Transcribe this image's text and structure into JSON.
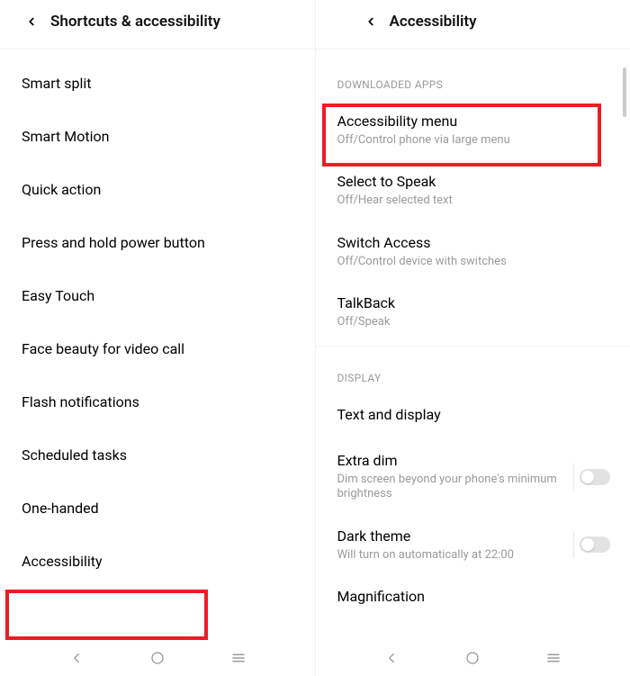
{
  "left": {
    "title": "Shortcuts & accessibility",
    "items": [
      "Smart split",
      "Smart Motion",
      "Quick action",
      "Press and hold power button",
      "Easy Touch",
      "Face beauty for video call",
      "Flash notifications",
      "Scheduled tasks",
      "One-handed",
      "Accessibility"
    ]
  },
  "right": {
    "title": "Accessibility",
    "sections": {
      "downloaded": {
        "header": "DOWNLOADED APPS",
        "items": [
          {
            "title": "Accessibility menu",
            "sub": "Off/Control phone via large menu"
          },
          {
            "title": "Select to Speak",
            "sub": "Off/Hear selected text"
          },
          {
            "title": "Switch Access",
            "sub": "Off/Control device with switches"
          },
          {
            "title": "TalkBack",
            "sub": "Off/Speak"
          }
        ]
      },
      "display": {
        "header": "DISPLAY",
        "items": [
          {
            "title": "Text and display",
            "sub": ""
          },
          {
            "title": "Extra dim",
            "sub": "Dim screen beyond your phone's minimum brightness",
            "toggle": false
          },
          {
            "title": "Dark theme",
            "sub": "Will turn on automatically at 22:00",
            "toggle": false
          },
          {
            "title": "Magnification",
            "sub": ""
          }
        ]
      }
    }
  }
}
